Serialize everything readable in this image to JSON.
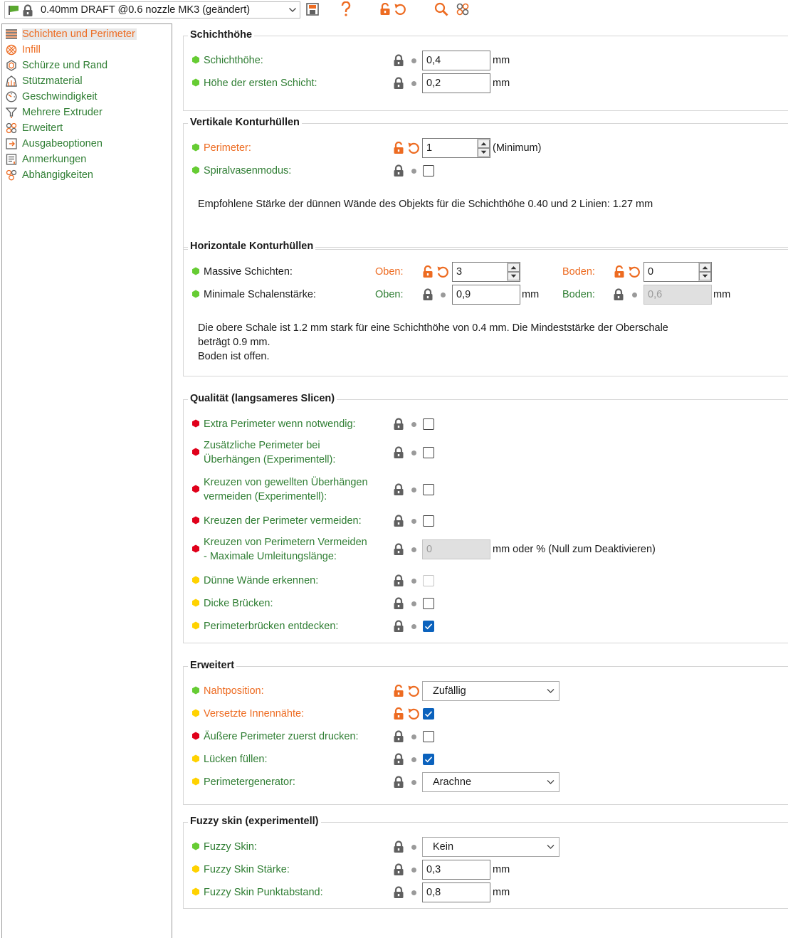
{
  "toolbar": {
    "preset": "0.40mm DRAFT @0.6 nozzle MK3 (geändert)",
    "icons": [
      "flag-icon",
      "lock-icon",
      "save-icon",
      "help-icon",
      "unlock-undo-icon",
      "search-icon",
      "compare-icon"
    ]
  },
  "sidebar": {
    "items": [
      {
        "label": "Schichten und Perimeter",
        "icon": "layers-icon",
        "active": true
      },
      {
        "label": "Infill",
        "icon": "infill-icon"
      },
      {
        "label": "Schürze und Rand",
        "icon": "skirt-icon"
      },
      {
        "label": "Stützmaterial",
        "icon": "support-icon"
      },
      {
        "label": "Geschwindigkeit",
        "icon": "speed-icon"
      },
      {
        "label": "Mehrere Extruder",
        "icon": "extruder-icon"
      },
      {
        "label": "Erweitert",
        "icon": "advanced-icon"
      },
      {
        "label": "Ausgabeoptionen",
        "icon": "output-icon"
      },
      {
        "label": "Anmerkungen",
        "icon": "notes-icon"
      },
      {
        "label": "Abhängigkeiten",
        "icon": "dependencies-icon"
      }
    ]
  },
  "colors": {
    "green": "#2e7d32",
    "orange": "#ed6b21",
    "red": "#e0001a",
    "yellow": "#ffd200",
    "checkbox": "#0b62bd"
  },
  "groups": {
    "layer_height": {
      "title": "Schichthöhe",
      "layer_height": {
        "label": "Schichthöhe:",
        "value": "0,4",
        "unit": "mm"
      },
      "first_layer": {
        "label": "Höhe der ersten Schicht:",
        "value": "0,2",
        "unit": "mm"
      }
    },
    "vertical": {
      "title": "Vertikale Konturhüllen",
      "perimeters": {
        "label": "Perimeter:",
        "value": "1",
        "unit": "(Minimum)"
      },
      "spiral": {
        "label": "Spiralvasenmodus:"
      },
      "note": "Empfohlene Stärke der dünnen Wände des Objekts für die Schichthöhe 0.40 und 2 Linien: 1.27 mm"
    },
    "horizontal": {
      "title": "Horizontale Konturhüllen",
      "solid_layers": {
        "label": "Massive Schichten:",
        "top_label": "Oben:",
        "top_value": "3",
        "bottom_label": "Boden:",
        "bottom_value": "0"
      },
      "min_shell": {
        "label": "Minimale Schalenstärke:",
        "top_label": "Oben:",
        "top_value": "0,9",
        "top_unit": "mm",
        "bottom_label": "Boden:",
        "bottom_value": "0,6",
        "bottom_unit": "mm"
      },
      "note_line1": "Die obere Schale ist 1.2 mm stark für eine Schichthöhe von 0.4 mm. Die Mindeststärke der Oberschale",
      "note_line2": "beträgt 0.9 mm.",
      "note_line3": "Boden ist offen."
    },
    "quality": {
      "title": "Qualität (langsameres Slicen)",
      "extra_perimeters": {
        "label": "Extra Perimeter wenn notwendig:"
      },
      "overhang_perimeters": {
        "line1": "Zusätzliche Perimeter bei",
        "line2": "Überhängen (Experimentell):"
      },
      "avoid_curled": {
        "line1": "Kreuzen von gewellten Überhängen",
        "line2": "vermeiden (Experimentell):"
      },
      "avoid_crossing": {
        "label": "Kreuzen der Perimeter vermeiden:"
      },
      "max_detour": {
        "line1": "Kreuzen von Perimetern Vermeiden",
        "line2": "- Maximale Umleitungslänge:",
        "value": "0",
        "unit": "mm oder % (Null zum Deaktivieren)"
      },
      "thin_walls": {
        "label": "Dünne Wände erkennen:"
      },
      "thick_bridges": {
        "label": "Dicke Brücken:"
      },
      "overhangs": {
        "label": "Perimeterbrücken entdecken:"
      }
    },
    "advanced": {
      "title": "Erweitert",
      "seam": {
        "label": "Nahtposition:",
        "value": "Zufällig"
      },
      "staggered": {
        "label": "Versetzte Innennähte:"
      },
      "external_first": {
        "label": "Äußere Perimeter zuerst drucken:"
      },
      "gap_fill": {
        "label": "Lücken füllen:"
      },
      "generator": {
        "label": "Perimetergenerator:",
        "value": "Arachne"
      }
    },
    "fuzzy": {
      "title": "Fuzzy skin (experimentell)",
      "fuzzy_skin": {
        "label": "Fuzzy Skin:",
        "value": "Kein"
      },
      "thickness": {
        "label": "Fuzzy Skin Stärke:",
        "value": "0,3",
        "unit": "mm"
      },
      "point_dist": {
        "label": "Fuzzy Skin Punktabstand:",
        "value": "0,8",
        "unit": "mm"
      }
    }
  }
}
